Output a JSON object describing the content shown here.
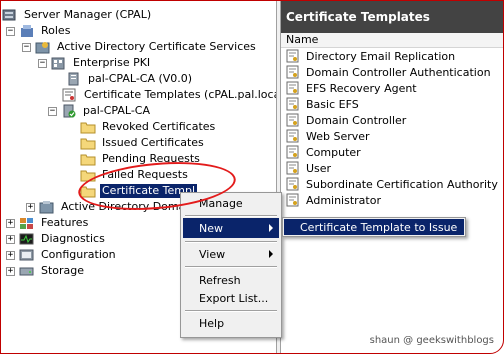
{
  "tree": {
    "root": "Server Manager (CPAL)",
    "roles": "Roles",
    "adcs": "Active Directory Certificate Services",
    "enterprise_pki": "Enterprise PKI",
    "pal_ca_v0": "pal-CPAL-CA (V0.0)",
    "cert_templates_node": "Certificate Templates (cPAL.pal.local)",
    "pal_ca": "pal-CPAL-CA",
    "revoked": "Revoked Certificates",
    "issued": "Issued Certificates",
    "pending": "Pending Requests",
    "failed": "Failed Requests",
    "cert_templates_sel": "Certificate Templ",
    "ad_domain": "Active Directory Domain",
    "features": "Features",
    "diagnostics": "Diagnostics",
    "configuration": "Configuration",
    "storage": "Storage"
  },
  "right_pane": {
    "title": "Certificate Templates",
    "column_name": "Name",
    "items": [
      "Directory Email Replication",
      "Domain Controller Authentication",
      "EFS Recovery Agent",
      "Basic EFS",
      "Domain Controller",
      "Web Server",
      "Computer",
      "User",
      "Subordinate Certification Authority",
      "Administrator"
    ]
  },
  "context_menu": {
    "manage": "Manage",
    "new": "New",
    "view": "View",
    "refresh": "Refresh",
    "export": "Export List...",
    "help": "Help"
  },
  "submenu": {
    "cert_template_to_issue": "Certificate Template to Issue"
  },
  "watermark": "shaun @ geekswithblogs",
  "colors": {
    "selection": "#0a246a",
    "title_bar": "#434343",
    "annotation": "#e31b1b"
  }
}
